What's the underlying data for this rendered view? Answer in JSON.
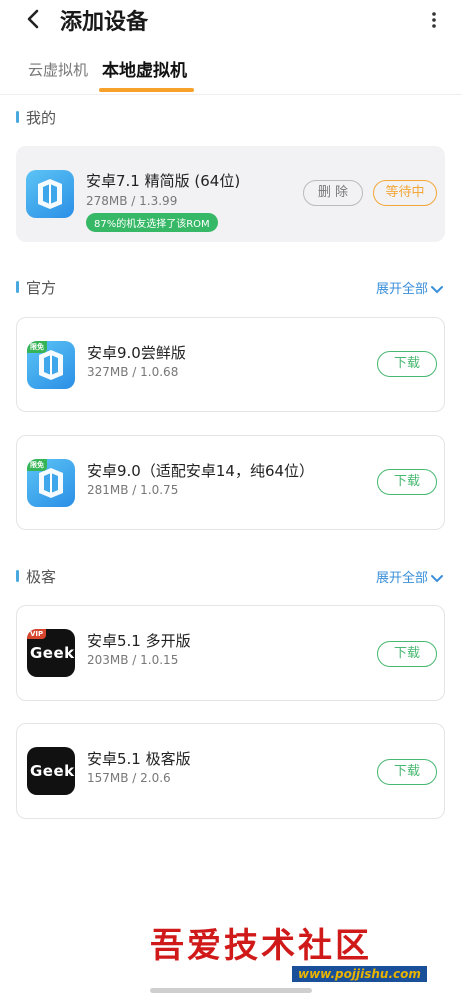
{
  "header": {
    "title": "添加设备"
  },
  "tabs": [
    {
      "label": "云虚拟机"
    },
    {
      "label": "本地虚拟机"
    }
  ],
  "sections": {
    "mine": {
      "title": "我的"
    },
    "official": {
      "title": "官方",
      "expand_label": "展开全部"
    },
    "geek": {
      "title": "极客",
      "expand_label": "展开全部"
    }
  },
  "apps": {
    "mine": {
      "name": "安卓7.1 精简版 (64位)",
      "meta": "278MB / 1.3.99",
      "tag": "87%的机友选择了该ROM",
      "delete_label": "删 除",
      "waiting_label": "等待中"
    },
    "official": [
      {
        "badge": "限免",
        "name": "安卓9.0尝鲜版",
        "meta": "327MB / 1.0.68",
        "action": "下载"
      },
      {
        "badge": "限免",
        "name": "安卓9.0（适配安卓14，纯64位）",
        "meta": "281MB / 1.0.75",
        "action": "下载"
      }
    ],
    "geek": [
      {
        "badge": "VIP",
        "icon_text": "Geek",
        "name": "安卓5.1 多开版",
        "meta": "203MB / 1.0.15",
        "action": "下载"
      },
      {
        "icon_text": "Geek",
        "name": "安卓5.1 极客版",
        "meta": "157MB / 2.0.6",
        "action": "下载"
      }
    ]
  },
  "watermark": {
    "text": "吾爱技术社区",
    "url": "www.pojjishu.com"
  },
  "colors": {
    "accent": "#f7a02a",
    "download": "#47b870",
    "link": "#3b8fd8",
    "tag": "#36b866"
  }
}
